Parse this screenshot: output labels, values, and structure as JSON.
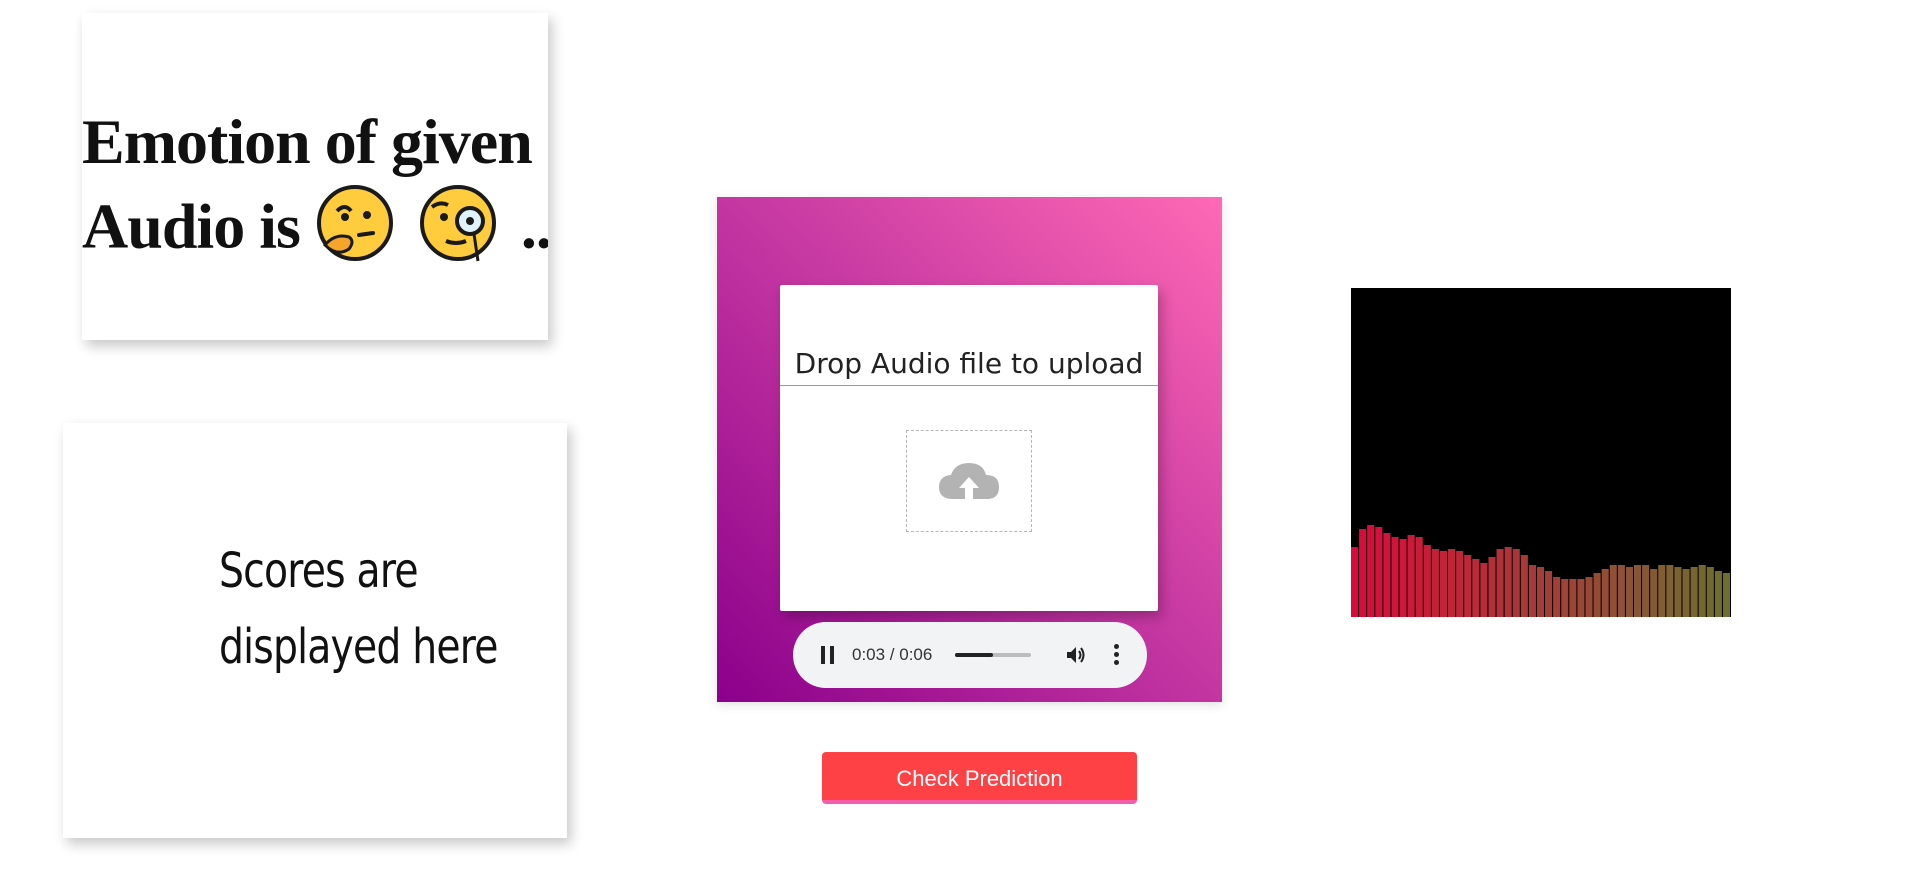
{
  "emotion_card": {
    "line1": "Emotion of given",
    "line2_prefix": "Audio is",
    "line2_suffix": "..",
    "emoji_1": "thinking-face-icon",
    "emoji_2": "face-with-monocle-icon"
  },
  "scores_card": {
    "line1": "Scores are",
    "line2": "displayed here"
  },
  "upload": {
    "title": "Drop Audio file to upload",
    "icon": "cloud-upload-icon"
  },
  "audio_player": {
    "time": "0:03 / 0:06",
    "progress": 0.5
  },
  "actions": {
    "check_label": "Check Prediction"
  },
  "colors": {
    "panel_gradient_start": "#ff69b4",
    "panel_gradient_end": "#8b008b",
    "button": "#fd4145",
    "button_border": "#f35ea8",
    "visualizer_bg": "#000000"
  }
}
